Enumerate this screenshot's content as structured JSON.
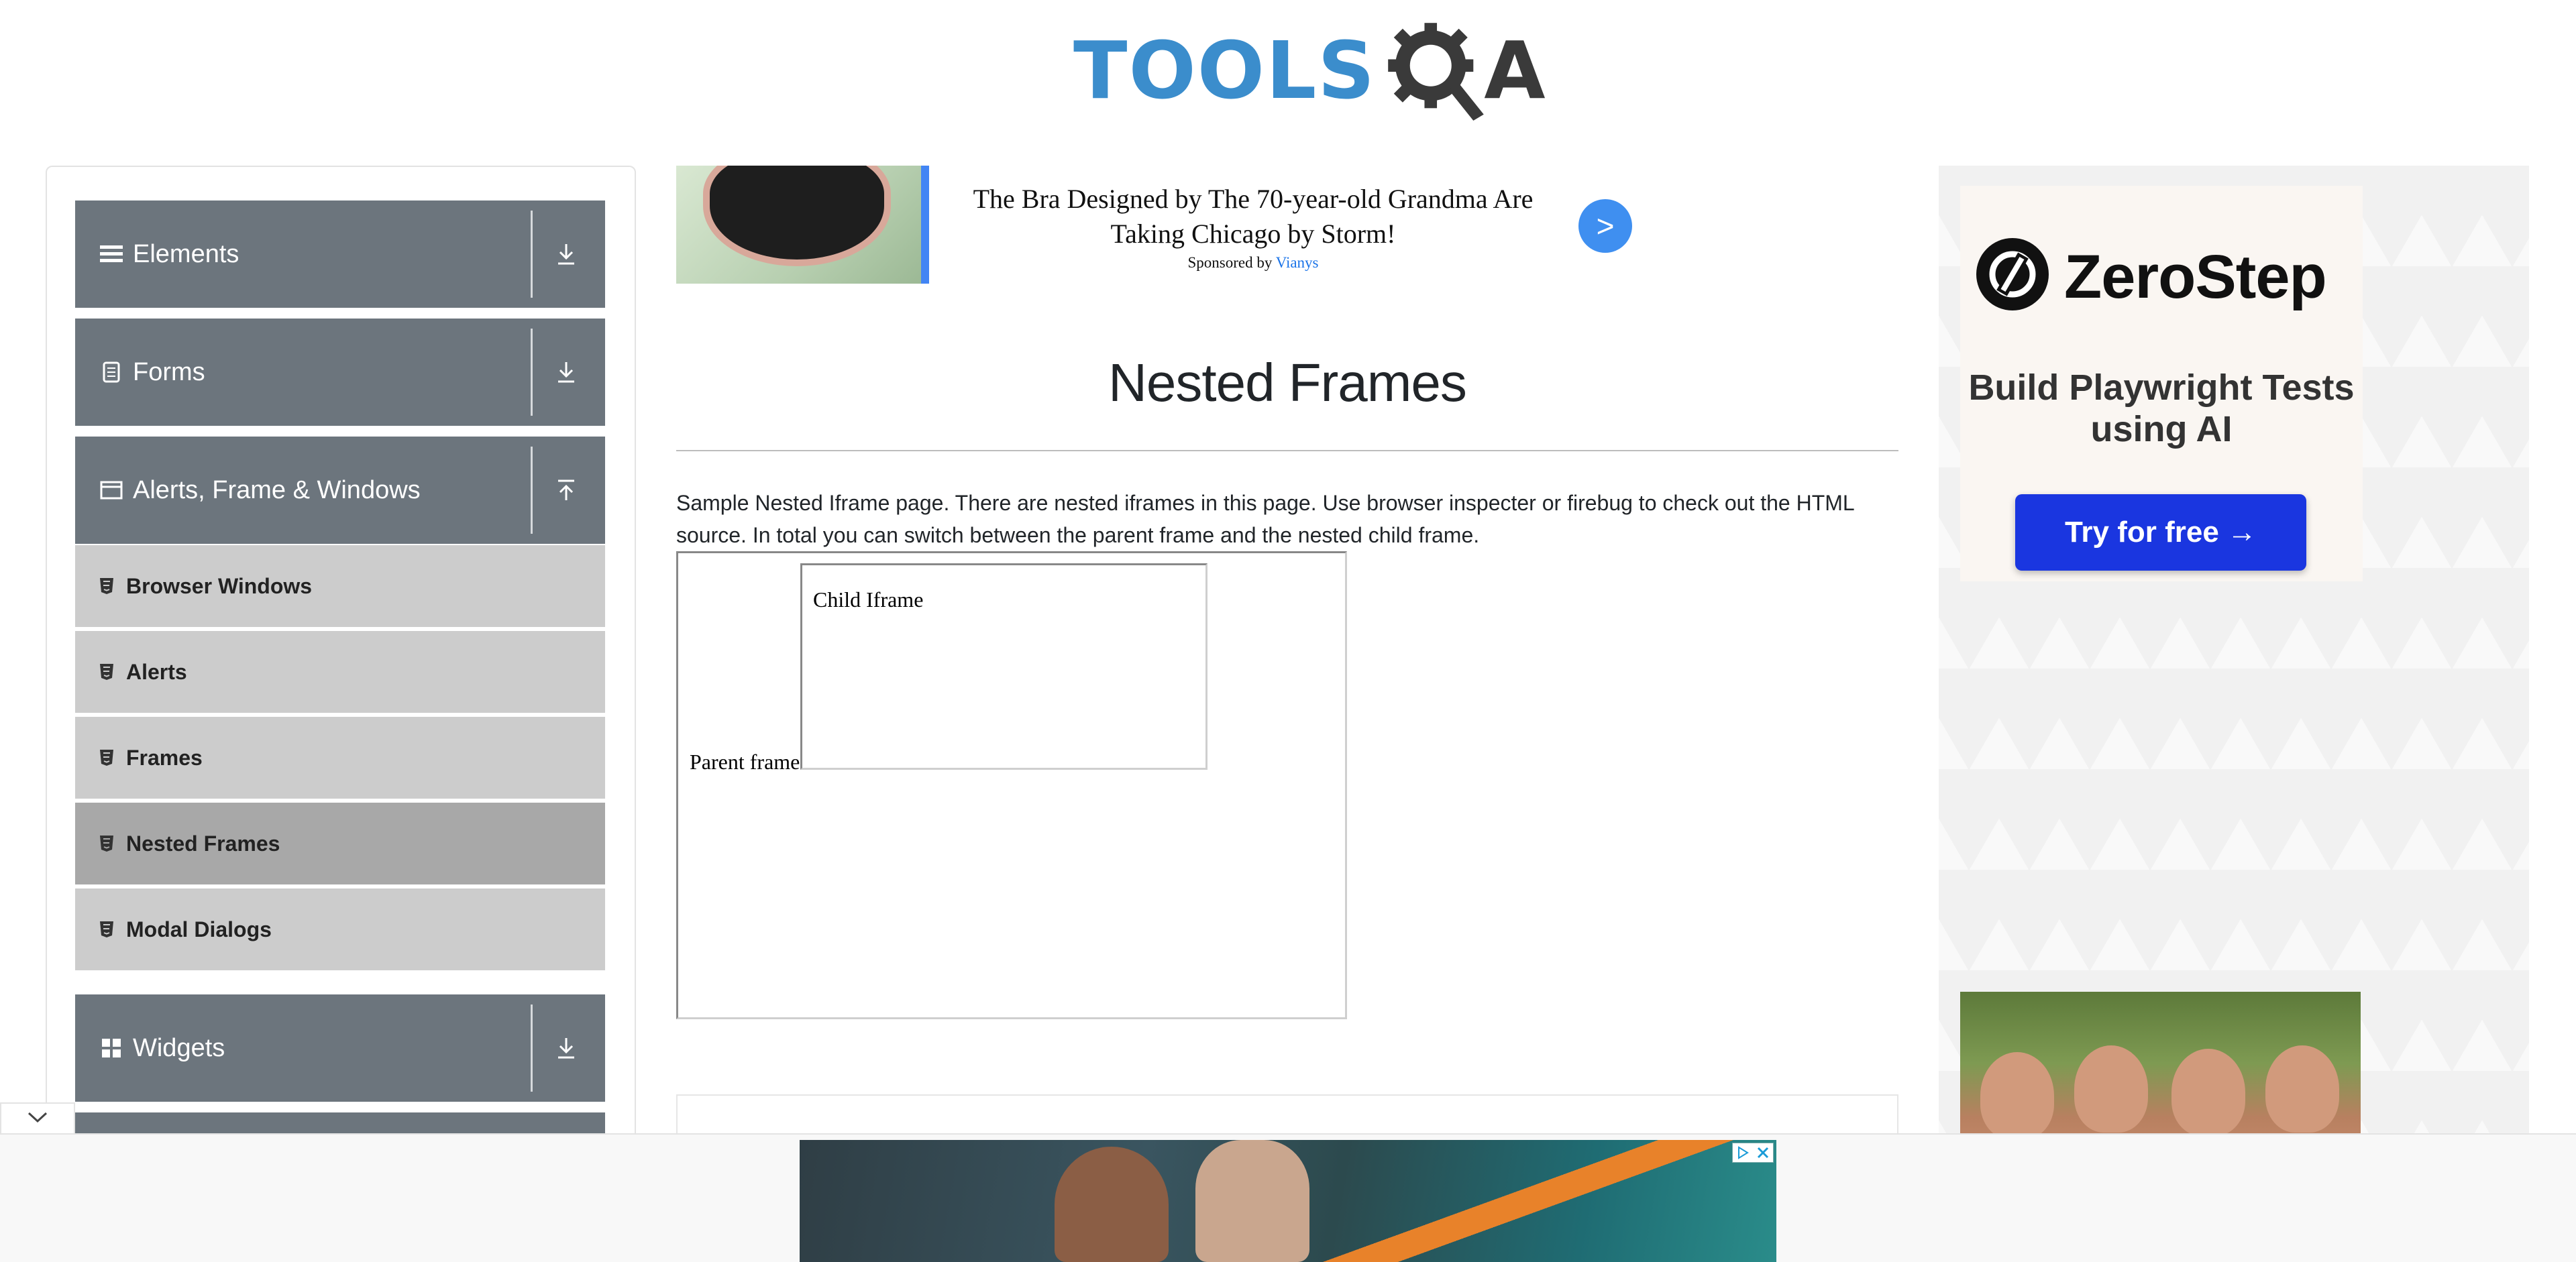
{
  "header": {
    "logo_text_part1": "TOOLS",
    "logo_text_part2": "A"
  },
  "sidebar": {
    "groups": [
      {
        "label": "Elements",
        "icon": "hamburger-icon",
        "toggle": "download-icon"
      },
      {
        "label": "Forms",
        "icon": "document-icon",
        "toggle": "download-icon"
      },
      {
        "label": "Alerts, Frame & Windows",
        "icon": "window-icon",
        "toggle": "upload-icon"
      },
      {
        "label": "Widgets",
        "icon": "grid-icon",
        "toggle": "download-icon"
      }
    ],
    "subitems": [
      {
        "label": "Browser Windows"
      },
      {
        "label": "Alerts"
      },
      {
        "label": "Frames"
      },
      {
        "label": "Nested Frames",
        "active": true
      },
      {
        "label": "Modal Dialogs"
      }
    ]
  },
  "top_ad": {
    "headline": "The Bra Designed by The 70-year-old Grandma Are Taking Chicago by Storm!",
    "sponsored_by": "Sponsored by",
    "sponsor": "Vianys",
    "go_label": ">"
  },
  "main": {
    "title": "Nested Frames",
    "description": "Sample Nested Iframe page. There are nested iframes in this page. Use browser inspecter or firebug to check out the HTML source. In total you can switch between the parent frame and the nested child frame.",
    "parent_frame_label": "Parent frame",
    "child_frame_label": "Child Iframe"
  },
  "right_ad": {
    "brand": "ZeroStep",
    "tagline": "Build Playwright Tests using AI",
    "cta": "Try for free →"
  },
  "colors": {
    "sidebar_header": "#6c757d",
    "sidebar_subitem": "#cccccc",
    "sidebar_active": "#a8a8a8",
    "logo_blue": "#3b8dcc",
    "cta_blue": "#1a36e0"
  }
}
